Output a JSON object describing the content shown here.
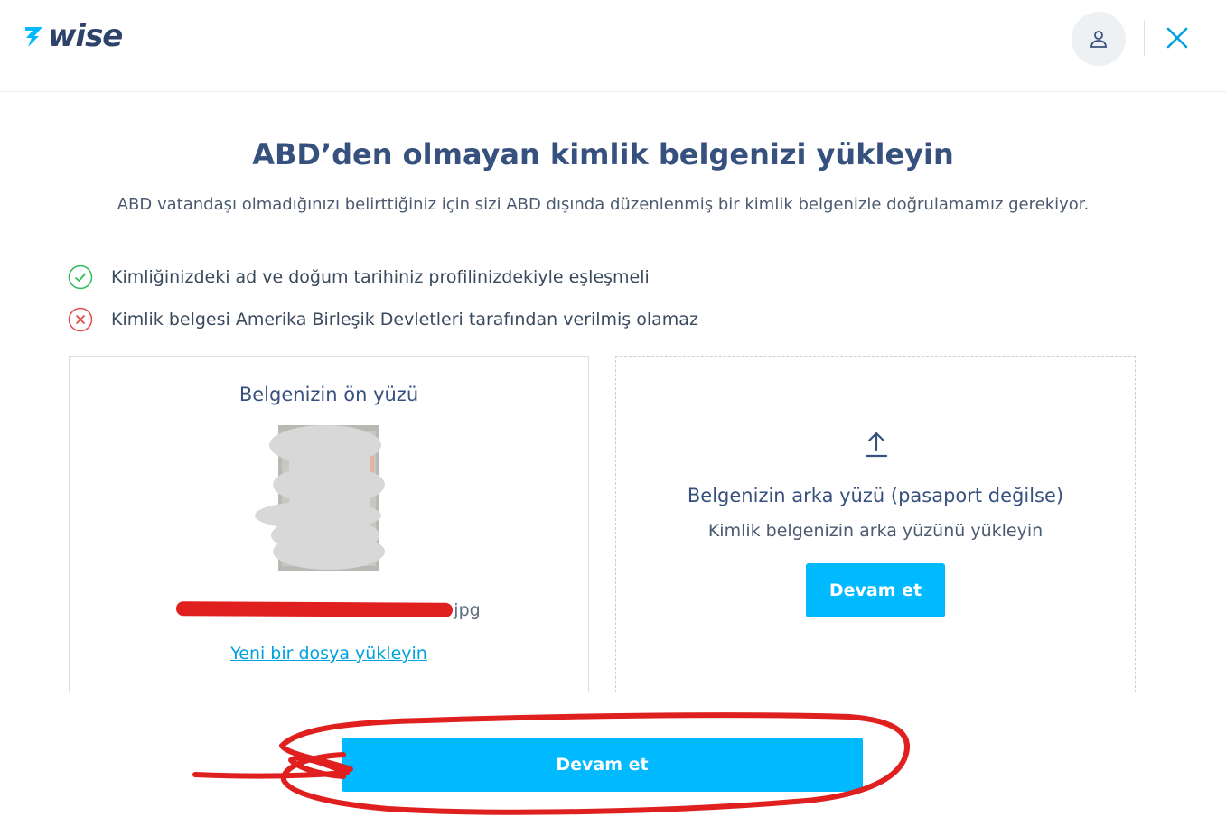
{
  "header": {
    "logo_text": "wise",
    "profile_icon": "user-icon",
    "close_icon": "close-icon"
  },
  "page": {
    "title": "ABD’den olmayan kimlik belgenizi yükleyin",
    "subtitle": "ABD vatandaşı olmadığınızı belirttiğiniz için sizi ABD dışında düzenlenmiş bir kimlik belgenizle doğrulamamız gerekiyor."
  },
  "requirements": [
    {
      "icon": "check-circle-icon",
      "status": "ok",
      "text": "Kimliğinizdeki ad ve doğum tarihiniz profilinizdekiyle eşleşmeli"
    },
    {
      "icon": "x-circle-icon",
      "status": "error",
      "text": "Kimlik belgesi Amerika Birleşik Devletleri tarafından verilmiş olamaz"
    }
  ],
  "front_card": {
    "title": "Belgenizin ön yüzü",
    "filename_suffix": "jpg",
    "upload_new_link": "Yeni bir dosya yükleyin"
  },
  "back_card": {
    "title": "Belgenizin arka yüzü (pasaport değilse)",
    "description": "Kimlik belgenizin arka yüzünü yükleyin",
    "button_label": "Devam et"
  },
  "footer": {
    "continue_label": "Devam et"
  },
  "colors": {
    "primary": "#00b9ff",
    "heading": "#37517e",
    "success": "#2ebd59",
    "error": "#e04b4b",
    "annotation": "#e01f1f"
  }
}
